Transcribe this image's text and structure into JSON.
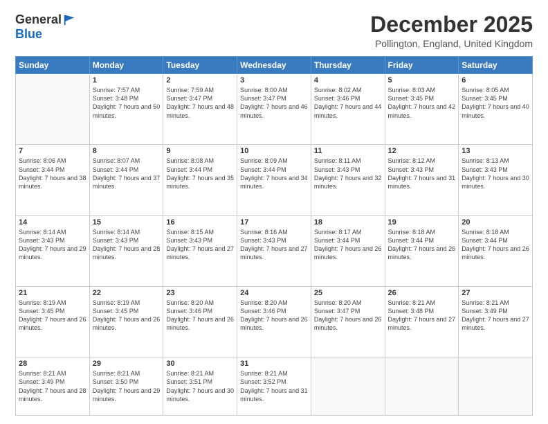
{
  "logo": {
    "general": "General",
    "blue": "Blue"
  },
  "title": "December 2025",
  "subtitle": "Pollington, England, United Kingdom",
  "days_of_week": [
    "Sunday",
    "Monday",
    "Tuesday",
    "Wednesday",
    "Thursday",
    "Friday",
    "Saturday"
  ],
  "weeks": [
    [
      {
        "day": "",
        "sunrise": "",
        "sunset": "",
        "daylight": ""
      },
      {
        "day": "1",
        "sunrise": "Sunrise: 7:57 AM",
        "sunset": "Sunset: 3:48 PM",
        "daylight": "Daylight: 7 hours and 50 minutes."
      },
      {
        "day": "2",
        "sunrise": "Sunrise: 7:59 AM",
        "sunset": "Sunset: 3:47 PM",
        "daylight": "Daylight: 7 hours and 48 minutes."
      },
      {
        "day": "3",
        "sunrise": "Sunrise: 8:00 AM",
        "sunset": "Sunset: 3:47 PM",
        "daylight": "Daylight: 7 hours and 46 minutes."
      },
      {
        "day": "4",
        "sunrise": "Sunrise: 8:02 AM",
        "sunset": "Sunset: 3:46 PM",
        "daylight": "Daylight: 7 hours and 44 minutes."
      },
      {
        "day": "5",
        "sunrise": "Sunrise: 8:03 AM",
        "sunset": "Sunset: 3:45 PM",
        "daylight": "Daylight: 7 hours and 42 minutes."
      },
      {
        "day": "6",
        "sunrise": "Sunrise: 8:05 AM",
        "sunset": "Sunset: 3:45 PM",
        "daylight": "Daylight: 7 hours and 40 minutes."
      }
    ],
    [
      {
        "day": "7",
        "sunrise": "Sunrise: 8:06 AM",
        "sunset": "Sunset: 3:44 PM",
        "daylight": "Daylight: 7 hours and 38 minutes."
      },
      {
        "day": "8",
        "sunrise": "Sunrise: 8:07 AM",
        "sunset": "Sunset: 3:44 PM",
        "daylight": "Daylight: 7 hours and 37 minutes."
      },
      {
        "day": "9",
        "sunrise": "Sunrise: 8:08 AM",
        "sunset": "Sunset: 3:44 PM",
        "daylight": "Daylight: 7 hours and 35 minutes."
      },
      {
        "day": "10",
        "sunrise": "Sunrise: 8:09 AM",
        "sunset": "Sunset: 3:44 PM",
        "daylight": "Daylight: 7 hours and 34 minutes."
      },
      {
        "day": "11",
        "sunrise": "Sunrise: 8:11 AM",
        "sunset": "Sunset: 3:43 PM",
        "daylight": "Daylight: 7 hours and 32 minutes."
      },
      {
        "day": "12",
        "sunrise": "Sunrise: 8:12 AM",
        "sunset": "Sunset: 3:43 PM",
        "daylight": "Daylight: 7 hours and 31 minutes."
      },
      {
        "day": "13",
        "sunrise": "Sunrise: 8:13 AM",
        "sunset": "Sunset: 3:43 PM",
        "daylight": "Daylight: 7 hours and 30 minutes."
      }
    ],
    [
      {
        "day": "14",
        "sunrise": "Sunrise: 8:14 AM",
        "sunset": "Sunset: 3:43 PM",
        "daylight": "Daylight: 7 hours and 29 minutes."
      },
      {
        "day": "15",
        "sunrise": "Sunrise: 8:14 AM",
        "sunset": "Sunset: 3:43 PM",
        "daylight": "Daylight: 7 hours and 28 minutes."
      },
      {
        "day": "16",
        "sunrise": "Sunrise: 8:15 AM",
        "sunset": "Sunset: 3:43 PM",
        "daylight": "Daylight: 7 hours and 27 minutes."
      },
      {
        "day": "17",
        "sunrise": "Sunrise: 8:16 AM",
        "sunset": "Sunset: 3:43 PM",
        "daylight": "Daylight: 7 hours and 27 minutes."
      },
      {
        "day": "18",
        "sunrise": "Sunrise: 8:17 AM",
        "sunset": "Sunset: 3:44 PM",
        "daylight": "Daylight: 7 hours and 26 minutes."
      },
      {
        "day": "19",
        "sunrise": "Sunrise: 8:18 AM",
        "sunset": "Sunset: 3:44 PM",
        "daylight": "Daylight: 7 hours and 26 minutes."
      },
      {
        "day": "20",
        "sunrise": "Sunrise: 8:18 AM",
        "sunset": "Sunset: 3:44 PM",
        "daylight": "Daylight: 7 hours and 26 minutes."
      }
    ],
    [
      {
        "day": "21",
        "sunrise": "Sunrise: 8:19 AM",
        "sunset": "Sunset: 3:45 PM",
        "daylight": "Daylight: 7 hours and 26 minutes."
      },
      {
        "day": "22",
        "sunrise": "Sunrise: 8:19 AM",
        "sunset": "Sunset: 3:45 PM",
        "daylight": "Daylight: 7 hours and 26 minutes."
      },
      {
        "day": "23",
        "sunrise": "Sunrise: 8:20 AM",
        "sunset": "Sunset: 3:46 PM",
        "daylight": "Daylight: 7 hours and 26 minutes."
      },
      {
        "day": "24",
        "sunrise": "Sunrise: 8:20 AM",
        "sunset": "Sunset: 3:46 PM",
        "daylight": "Daylight: 7 hours and 26 minutes."
      },
      {
        "day": "25",
        "sunrise": "Sunrise: 8:20 AM",
        "sunset": "Sunset: 3:47 PM",
        "daylight": "Daylight: 7 hours and 26 minutes."
      },
      {
        "day": "26",
        "sunrise": "Sunrise: 8:21 AM",
        "sunset": "Sunset: 3:48 PM",
        "daylight": "Daylight: 7 hours and 27 minutes."
      },
      {
        "day": "27",
        "sunrise": "Sunrise: 8:21 AM",
        "sunset": "Sunset: 3:49 PM",
        "daylight": "Daylight: 7 hours and 27 minutes."
      }
    ],
    [
      {
        "day": "28",
        "sunrise": "Sunrise: 8:21 AM",
        "sunset": "Sunset: 3:49 PM",
        "daylight": "Daylight: 7 hours and 28 minutes."
      },
      {
        "day": "29",
        "sunrise": "Sunrise: 8:21 AM",
        "sunset": "Sunset: 3:50 PM",
        "daylight": "Daylight: 7 hours and 29 minutes."
      },
      {
        "day": "30",
        "sunrise": "Sunrise: 8:21 AM",
        "sunset": "Sunset: 3:51 PM",
        "daylight": "Daylight: 7 hours and 30 minutes."
      },
      {
        "day": "31",
        "sunrise": "Sunrise: 8:21 AM",
        "sunset": "Sunset: 3:52 PM",
        "daylight": "Daylight: 7 hours and 31 minutes."
      },
      {
        "day": "",
        "sunrise": "",
        "sunset": "",
        "daylight": ""
      },
      {
        "day": "",
        "sunrise": "",
        "sunset": "",
        "daylight": ""
      },
      {
        "day": "",
        "sunrise": "",
        "sunset": "",
        "daylight": ""
      }
    ]
  ]
}
